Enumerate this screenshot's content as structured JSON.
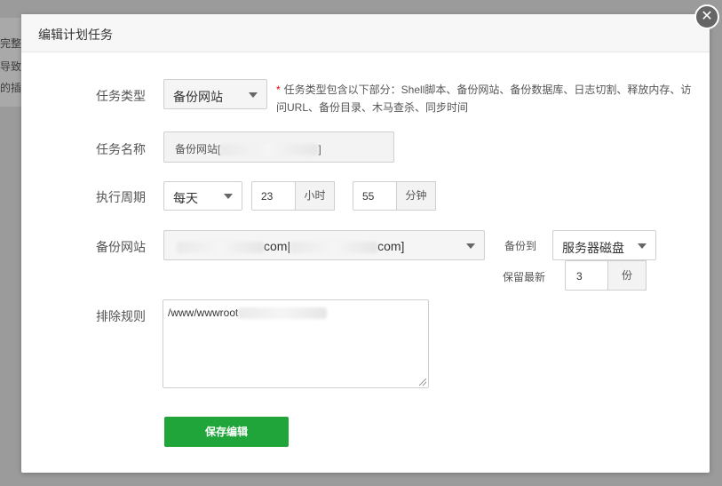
{
  "background": {
    "lines": [
      "完整",
      "导致数",
      "的插件"
    ]
  },
  "modal": {
    "title": "编辑计划任务",
    "close_symbol": "✕"
  },
  "form": {
    "task_type": {
      "label": "任务类型",
      "value": "备份网站",
      "hint_star": "*",
      "hint": "任务类型包含以下部分：Shell脚本、备份网站、备份数据库、日志切割、释放内存、访问URL、备份目录、木马查杀、同步时间"
    },
    "task_name": {
      "label": "任务名称",
      "value_prefix": "备份网站[",
      "value_suffix": "]"
    },
    "period": {
      "label": "执行周期",
      "freq": "每天",
      "hour": "23",
      "hour_unit": "小时",
      "minute": "55",
      "minute_unit": "分钟"
    },
    "backup_site": {
      "label": "备份网站",
      "value_part1": "com|",
      "value_part2": "com]"
    },
    "backup_to": {
      "label": "备份到",
      "value": "服务器磁盘"
    },
    "keep_latest": {
      "label": "保留最新",
      "value": "3",
      "unit": "份"
    },
    "exclude": {
      "label": "排除规则",
      "value": "/www/wwwroot"
    },
    "save_label": "保存编辑"
  },
  "colors": {
    "primary": "#20a53a",
    "required": "#ee0000"
  }
}
